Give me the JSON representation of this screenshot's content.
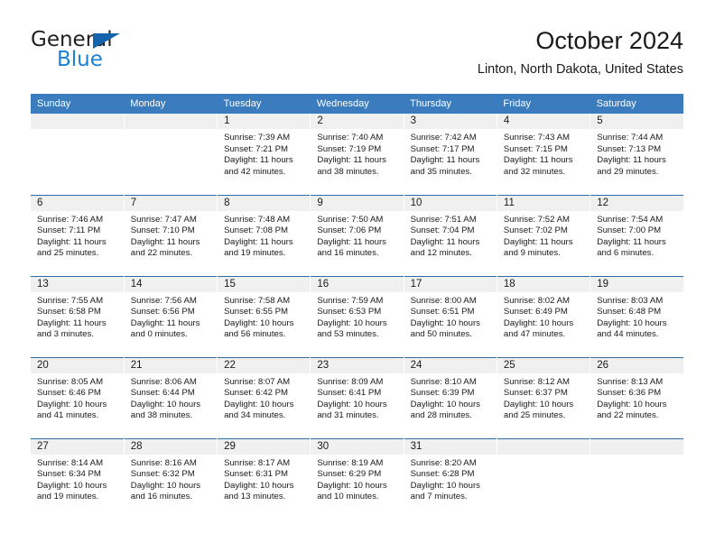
{
  "brand": {
    "name_part1": "General",
    "name_part2": "Blue",
    "triangle_color": "#1263ab",
    "blue_color": "#1b7fd4"
  },
  "header": {
    "title": "October 2024",
    "location": "Linton, North Dakota, United States"
  },
  "theme": {
    "header_bar": "#3a7cbe",
    "row_rule": "#2e6da4",
    "daynum_band": "#f0f0f0",
    "text": "#1a1a1a"
  },
  "weekdays": [
    "Sunday",
    "Monday",
    "Tuesday",
    "Wednesday",
    "Thursday",
    "Friday",
    "Saturday"
  ],
  "labels": {
    "sunrise_prefix": "Sunrise:",
    "sunset_prefix": "Sunset:",
    "daylight_prefix": "Daylight:"
  },
  "weeks": [
    [
      {
        "day": "",
        "sunrise": "",
        "sunset": "",
        "daylight": ""
      },
      {
        "day": "",
        "sunrise": "",
        "sunset": "",
        "daylight": ""
      },
      {
        "day": "1",
        "sunrise": "Sunrise: 7:39 AM",
        "sunset": "Sunset: 7:21 PM",
        "daylight": "Daylight: 11 hours and 42 minutes."
      },
      {
        "day": "2",
        "sunrise": "Sunrise: 7:40 AM",
        "sunset": "Sunset: 7:19 PM",
        "daylight": "Daylight: 11 hours and 38 minutes."
      },
      {
        "day": "3",
        "sunrise": "Sunrise: 7:42 AM",
        "sunset": "Sunset: 7:17 PM",
        "daylight": "Daylight: 11 hours and 35 minutes."
      },
      {
        "day": "4",
        "sunrise": "Sunrise: 7:43 AM",
        "sunset": "Sunset: 7:15 PM",
        "daylight": "Daylight: 11 hours and 32 minutes."
      },
      {
        "day": "5",
        "sunrise": "Sunrise: 7:44 AM",
        "sunset": "Sunset: 7:13 PM",
        "daylight": "Daylight: 11 hours and 29 minutes."
      }
    ],
    [
      {
        "day": "6",
        "sunrise": "Sunrise: 7:46 AM",
        "sunset": "Sunset: 7:11 PM",
        "daylight": "Daylight: 11 hours and 25 minutes."
      },
      {
        "day": "7",
        "sunrise": "Sunrise: 7:47 AM",
        "sunset": "Sunset: 7:10 PM",
        "daylight": "Daylight: 11 hours and 22 minutes."
      },
      {
        "day": "8",
        "sunrise": "Sunrise: 7:48 AM",
        "sunset": "Sunset: 7:08 PM",
        "daylight": "Daylight: 11 hours and 19 minutes."
      },
      {
        "day": "9",
        "sunrise": "Sunrise: 7:50 AM",
        "sunset": "Sunset: 7:06 PM",
        "daylight": "Daylight: 11 hours and 16 minutes."
      },
      {
        "day": "10",
        "sunrise": "Sunrise: 7:51 AM",
        "sunset": "Sunset: 7:04 PM",
        "daylight": "Daylight: 11 hours and 12 minutes."
      },
      {
        "day": "11",
        "sunrise": "Sunrise: 7:52 AM",
        "sunset": "Sunset: 7:02 PM",
        "daylight": "Daylight: 11 hours and 9 minutes."
      },
      {
        "day": "12",
        "sunrise": "Sunrise: 7:54 AM",
        "sunset": "Sunset: 7:00 PM",
        "daylight": "Daylight: 11 hours and 6 minutes."
      }
    ],
    [
      {
        "day": "13",
        "sunrise": "Sunrise: 7:55 AM",
        "sunset": "Sunset: 6:58 PM",
        "daylight": "Daylight: 11 hours and 3 minutes."
      },
      {
        "day": "14",
        "sunrise": "Sunrise: 7:56 AM",
        "sunset": "Sunset: 6:56 PM",
        "daylight": "Daylight: 11 hours and 0 minutes."
      },
      {
        "day": "15",
        "sunrise": "Sunrise: 7:58 AM",
        "sunset": "Sunset: 6:55 PM",
        "daylight": "Daylight: 10 hours and 56 minutes."
      },
      {
        "day": "16",
        "sunrise": "Sunrise: 7:59 AM",
        "sunset": "Sunset: 6:53 PM",
        "daylight": "Daylight: 10 hours and 53 minutes."
      },
      {
        "day": "17",
        "sunrise": "Sunrise: 8:00 AM",
        "sunset": "Sunset: 6:51 PM",
        "daylight": "Daylight: 10 hours and 50 minutes."
      },
      {
        "day": "18",
        "sunrise": "Sunrise: 8:02 AM",
        "sunset": "Sunset: 6:49 PM",
        "daylight": "Daylight: 10 hours and 47 minutes."
      },
      {
        "day": "19",
        "sunrise": "Sunrise: 8:03 AM",
        "sunset": "Sunset: 6:48 PM",
        "daylight": "Daylight: 10 hours and 44 minutes."
      }
    ],
    [
      {
        "day": "20",
        "sunrise": "Sunrise: 8:05 AM",
        "sunset": "Sunset: 6:46 PM",
        "daylight": "Daylight: 10 hours and 41 minutes."
      },
      {
        "day": "21",
        "sunrise": "Sunrise: 8:06 AM",
        "sunset": "Sunset: 6:44 PM",
        "daylight": "Daylight: 10 hours and 38 minutes."
      },
      {
        "day": "22",
        "sunrise": "Sunrise: 8:07 AM",
        "sunset": "Sunset: 6:42 PM",
        "daylight": "Daylight: 10 hours and 34 minutes."
      },
      {
        "day": "23",
        "sunrise": "Sunrise: 8:09 AM",
        "sunset": "Sunset: 6:41 PM",
        "daylight": "Daylight: 10 hours and 31 minutes."
      },
      {
        "day": "24",
        "sunrise": "Sunrise: 8:10 AM",
        "sunset": "Sunset: 6:39 PM",
        "daylight": "Daylight: 10 hours and 28 minutes."
      },
      {
        "day": "25",
        "sunrise": "Sunrise: 8:12 AM",
        "sunset": "Sunset: 6:37 PM",
        "daylight": "Daylight: 10 hours and 25 minutes."
      },
      {
        "day": "26",
        "sunrise": "Sunrise: 8:13 AM",
        "sunset": "Sunset: 6:36 PM",
        "daylight": "Daylight: 10 hours and 22 minutes."
      }
    ],
    [
      {
        "day": "27",
        "sunrise": "Sunrise: 8:14 AM",
        "sunset": "Sunset: 6:34 PM",
        "daylight": "Daylight: 10 hours and 19 minutes."
      },
      {
        "day": "28",
        "sunrise": "Sunrise: 8:16 AM",
        "sunset": "Sunset: 6:32 PM",
        "daylight": "Daylight: 10 hours and 16 minutes."
      },
      {
        "day": "29",
        "sunrise": "Sunrise: 8:17 AM",
        "sunset": "Sunset: 6:31 PM",
        "daylight": "Daylight: 10 hours and 13 minutes."
      },
      {
        "day": "30",
        "sunrise": "Sunrise: 8:19 AM",
        "sunset": "Sunset: 6:29 PM",
        "daylight": "Daylight: 10 hours and 10 minutes."
      },
      {
        "day": "31",
        "sunrise": "Sunrise: 8:20 AM",
        "sunset": "Sunset: 6:28 PM",
        "daylight": "Daylight: 10 hours and 7 minutes."
      },
      {
        "day": "",
        "sunrise": "",
        "sunset": "",
        "daylight": ""
      },
      {
        "day": "",
        "sunrise": "",
        "sunset": "",
        "daylight": ""
      }
    ]
  ]
}
